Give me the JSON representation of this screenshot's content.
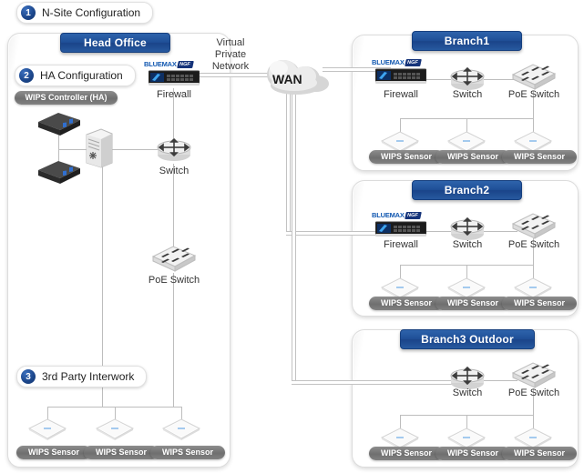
{
  "callouts": [
    {
      "num": "1",
      "label": "N-Site Configuration"
    },
    {
      "num": "2",
      "label": "HA Configuration"
    },
    {
      "num": "3",
      "label": "3rd Party Interwork"
    }
  ],
  "wan": {
    "label": "WAN",
    "vpn_label": "Virtual\nPrivate\nNetwork",
    "vpn_line1": "Virtual",
    "vpn_line2": "Private",
    "vpn_line3": "Network"
  },
  "brand": {
    "name": "BLUEMAX",
    "tag": "NGF"
  },
  "sites": {
    "head_office": {
      "title": "Head Office",
      "controller_label": "WIPS Controller (HA)",
      "firewall_label": "Firewall",
      "switch_label": "Switch",
      "poe_label": "PoE Switch",
      "sensors": [
        "WIPS Sensor",
        "WIPS Sensor",
        "WIPS Sensor"
      ]
    },
    "branch1": {
      "title": "Branch1",
      "firewall_label": "Firewall",
      "switch_label": "Switch",
      "poe_label": "PoE Switch",
      "sensors": [
        "WIPS Sensor",
        "WIPS Sensor",
        "WIPS Sensor"
      ]
    },
    "branch2": {
      "title": "Branch2",
      "firewall_label": "Firewall",
      "switch_label": "Switch",
      "poe_label": "PoE Switch",
      "sensors": [
        "WIPS Sensor",
        "WIPS Sensor",
        "WIPS Sensor"
      ]
    },
    "branch3": {
      "title": "Branch3 Outdoor",
      "switch_label": "Switch",
      "poe_label": "PoE Switch",
      "sensors": [
        "WIPS Sensor",
        "WIPS Sensor",
        "WIPS Sensor"
      ]
    }
  },
  "colors": {
    "header_blue": "#1f4f97",
    "badge_blue": "#1b4589",
    "capsule_gray": "#6f6f6f",
    "line_gray": "#bdbdbd",
    "logo_blue": "#1057b0"
  }
}
